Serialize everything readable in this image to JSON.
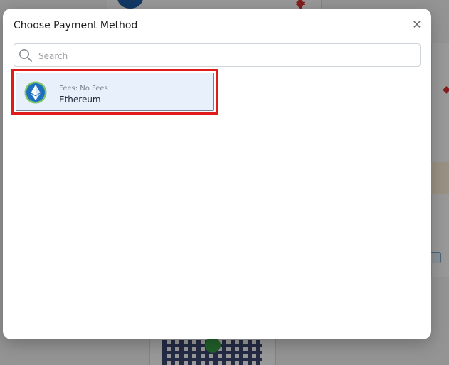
{
  "modal": {
    "title": "Choose Payment Method",
    "close_icon": "close-icon",
    "search": {
      "placeholder": "Search",
      "value": "",
      "icon": "search-icon"
    },
    "methods": [
      {
        "fees": "Fees: No Fees",
        "name": "Ethereum",
        "icon": "ethereum-icon",
        "selected": true
      }
    ]
  },
  "colors": {
    "highlight": "#e01b1b",
    "item_bg": "#e8f1fb",
    "ethereum_blue": "#1f6fbf",
    "ethereum_ring": "#7cc46a"
  }
}
